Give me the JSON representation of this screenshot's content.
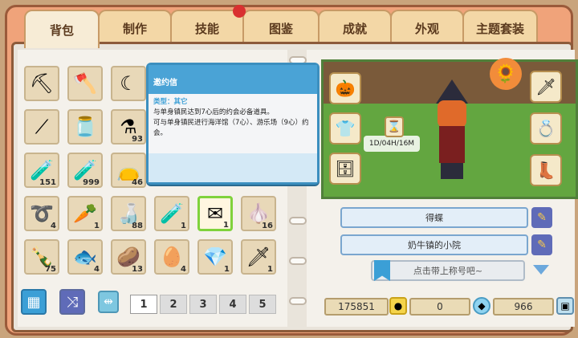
{
  "tabs": [
    {
      "label": "背包",
      "active": true
    },
    {
      "label": "制作"
    },
    {
      "label": "技能"
    },
    {
      "label": "图鉴"
    },
    {
      "label": "成就"
    },
    {
      "label": "外观"
    },
    {
      "label": "主题套装"
    }
  ],
  "inventory": {
    "slots": [
      {
        "icon": "pickaxe-icon",
        "glyph": "⛏",
        "count": ""
      },
      {
        "icon": "axe-icon",
        "glyph": "🪓",
        "count": ""
      },
      {
        "icon": "sickle-icon",
        "glyph": "☾",
        "count": ""
      },
      {
        "icon": "fishing-rod-icon",
        "glyph": "⟋",
        "count": ""
      },
      {
        "icon": "jar-icon",
        "glyph": "🫙",
        "count": ""
      },
      {
        "icon": "red-potion-icon",
        "glyph": "⚗",
        "count": "93"
      },
      {
        "icon": "blue-vial-icon",
        "glyph": "🧪",
        "count": "151"
      },
      {
        "icon": "blue-vial-icon",
        "glyph": "🧪",
        "count": "999"
      },
      {
        "icon": "blue-pouch-icon",
        "glyph": "👝",
        "count": "46"
      },
      {
        "icon": "green-vial-icon",
        "glyph": "🧪",
        "count": "1"
      },
      {
        "icon": "love-letter-icon",
        "glyph": "✉",
        "count": "1"
      },
      {
        "icon": "garlic-icon",
        "glyph": "🧄",
        "count": "16"
      },
      {
        "icon": "blue-ring-icon",
        "glyph": "➰",
        "count": "4"
      },
      {
        "icon": "root-icon",
        "glyph": "🥕",
        "count": "1"
      },
      {
        "icon": "milk-bottle-icon",
        "glyph": "🍶",
        "count": "88"
      },
      {
        "icon": "bottle-icon",
        "glyph": "🍾",
        "count": "75"
      },
      {
        "icon": "fish-icon",
        "glyph": "🐟",
        "count": "4"
      },
      {
        "icon": "potato-icon",
        "glyph": "🥔",
        "count": "13"
      },
      {
        "icon": "egg-icon",
        "glyph": "🥚",
        "count": "4"
      },
      {
        "icon": "crystal-icon",
        "glyph": "💎",
        "count": "1"
      },
      {
        "icon": "knife-icon",
        "glyph": "🗡",
        "count": "1"
      }
    ]
  },
  "tooltip": {
    "title": "邀约信",
    "type_label": "类型：其它",
    "line1": "与单身镇民达到7心后的约会必备道具。",
    "line2": "可与单身镇民进行海洋馆（7心）、游乐场（9心）约会。"
  },
  "pagination": {
    "pages": [
      "1",
      "2",
      "3",
      "4",
      "5"
    ],
    "active": "1"
  },
  "character": {
    "timer": "1D/04H/16M"
  },
  "profile": {
    "name": "得蝶",
    "farm": "奶牛镇的小院",
    "title_placeholder": "点击带上称号吧~"
  },
  "currency": {
    "gold": "175851",
    "gems": "0",
    "tokens": "966"
  },
  "colors": {
    "accent": "#4aa3d6",
    "frame": "#f0a37a",
    "selected": "#7fd23c"
  }
}
